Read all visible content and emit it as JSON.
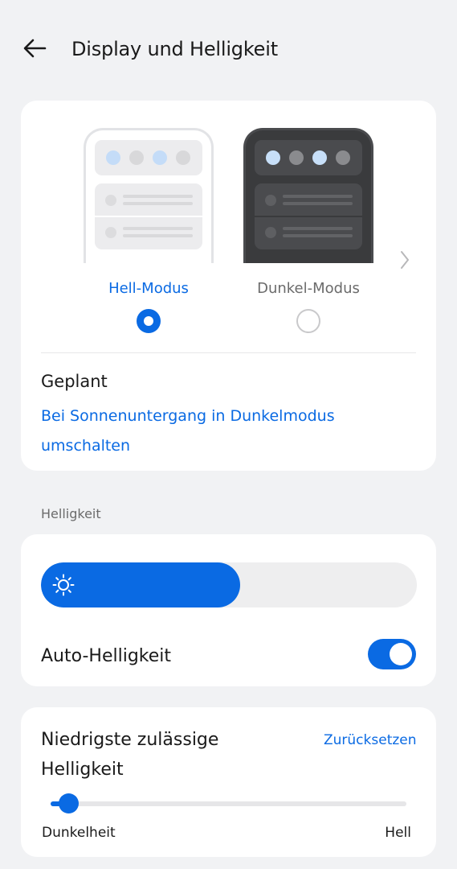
{
  "header": {
    "back_icon": "arrow-left-icon",
    "title": "Display und Helligkeit"
  },
  "theme": {
    "light_label": "Hell-Modus",
    "dark_label": "Dunkel-Modus",
    "selected": "light",
    "scheduled": {
      "title": "Geplant",
      "subtitle": "Bei Sonnenuntergang in Dunkelmodus umschalten",
      "chevron_icon": "chevron-right-icon"
    }
  },
  "brightness": {
    "section_label": "Helligkeit",
    "level": 0.53,
    "sun_icon": "sun-icon",
    "auto_label": "Auto-Helligkeit",
    "auto_enabled": true
  },
  "min_brightness": {
    "title": "Niedrigste zulässige Helligkeit",
    "reset_label": "Zurücksetzen",
    "level": 0.05,
    "min_label": "Dunkelheit",
    "max_label": "Hell"
  },
  "colors": {
    "accent": "#0a6ae3",
    "background": "#f1f2f4",
    "card": "#ffffff"
  }
}
